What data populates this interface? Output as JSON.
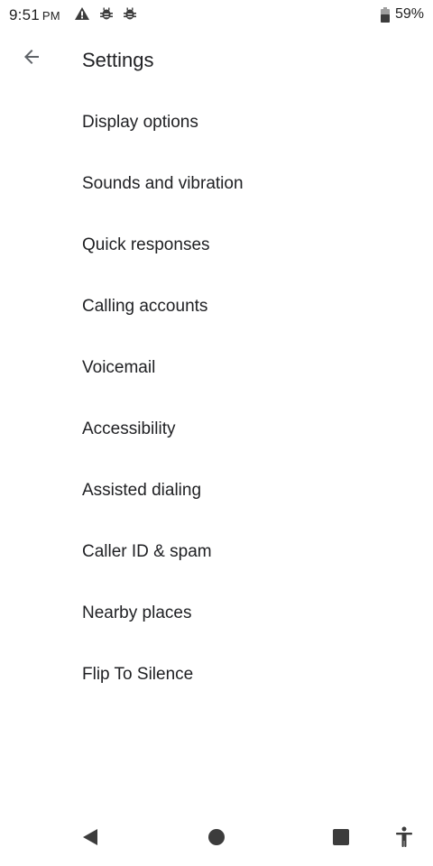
{
  "status_bar": {
    "time": "9:51",
    "ampm": "PM",
    "battery": "59%",
    "icons": [
      "warning-icon",
      "bug-icon",
      "bug-icon",
      "battery-icon"
    ]
  },
  "header": {
    "back_icon": "arrow-back-icon",
    "title": "Settings"
  },
  "settings": {
    "items": [
      {
        "label": "Display options"
      },
      {
        "label": "Sounds and vibration"
      },
      {
        "label": "Quick responses"
      },
      {
        "label": "Calling accounts"
      },
      {
        "label": "Voicemail"
      },
      {
        "label": "Accessibility"
      },
      {
        "label": "Assisted dialing"
      },
      {
        "label": "Caller ID & spam"
      },
      {
        "label": "Nearby places"
      },
      {
        "label": "Flip To Silence"
      }
    ]
  },
  "nav_bar": {
    "icons": [
      "nav-back-icon",
      "nav-home-icon",
      "nav-recents-icon",
      "accessibility-icon"
    ]
  },
  "colors": {
    "background": "#ffffff",
    "text": "#202124",
    "icon": "#5f6368"
  }
}
